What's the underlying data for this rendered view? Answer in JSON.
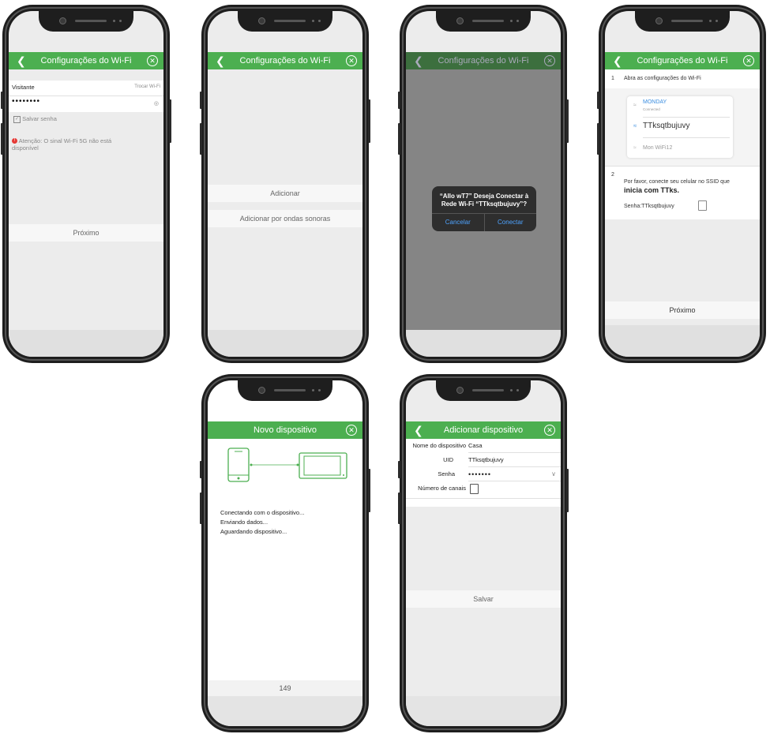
{
  "colors": {
    "header_green": "#4caf50",
    "alert_blue": "#4ea3ff",
    "error_red": "#e53935"
  },
  "screen1": {
    "title": "Configurações do Wi-Fi",
    "network_name": "Visitante",
    "change_wifi": "Trocar Wi-Fi",
    "password_mask": "••••••••",
    "save_password": "Salvar senha",
    "warning": "Atenção: O sinal Wi-Fi 5G não está disponível",
    "next_button": "Próximo",
    "icons": [
      "back-icon",
      "close-icon",
      "eye-icon",
      "checkbox-icon",
      "error-icon"
    ]
  },
  "screen2": {
    "title": "Configurações do Wi-Fi",
    "add_button": "Adicionar",
    "add_sound_button": "Adicionar por ondas sonoras"
  },
  "screen3": {
    "title": "Configurações do Wi-Fi",
    "alert_text": "“Allo wT7” Deseja Conectar à Rede Wi-Fi “TTksqtbujuvy”?",
    "cancel": "Cancelar",
    "connect": "Conectar"
  },
  "screen4": {
    "title": "Configurações do Wi-Fi",
    "step1_num": "1",
    "step1_text": "Abra as configurações do Wi-Fi",
    "networks": [
      {
        "name": "MONDAY",
        "status": "Connected"
      },
      {
        "name": "TTksqtbujuvy"
      },
      {
        "name": "Mon WiFi12"
      }
    ],
    "step2_num": "2",
    "step2_text": "Por favor, conecte seu celular no SSID que",
    "step2_bold": "inicia com TTks.",
    "password_label": "Senha:TTksqtbujuvy",
    "next_button": "Próximo"
  },
  "screen5": {
    "title": "Novo dispositivo",
    "status_lines": [
      "Conectando com o dispositivo...",
      "Enviando dados...",
      "Aguardando dispositivo..."
    ],
    "counter": "149"
  },
  "screen6": {
    "title": "Adicionar dispositivo",
    "device_name_label": "Nome do dispositivo",
    "device_name_value": "Casa",
    "uid_label": "UID",
    "uid_value": "TTksqtbujuvy",
    "password_label": "Senha",
    "password_mask": "•••••••",
    "channels_label": "Número de canais",
    "save_button": "Salvar"
  }
}
